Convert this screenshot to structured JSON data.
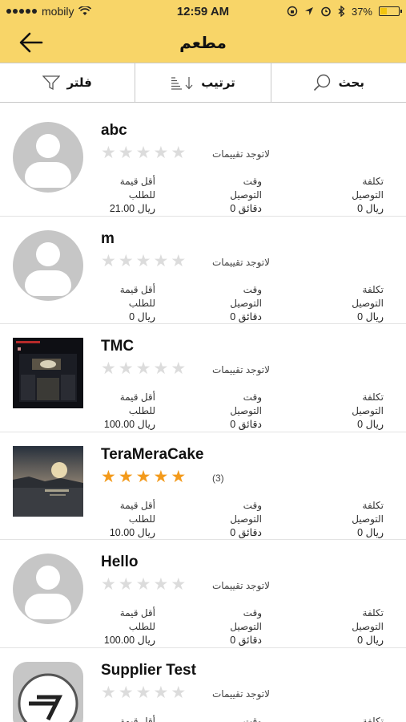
{
  "status": {
    "carrier": "mobily",
    "time": "12:59 AM",
    "battery": "37%",
    "battery_level": 0.37
  },
  "nav": {
    "title": "مطعم"
  },
  "toolbar": {
    "filter": "فلتر",
    "sort": "ترتيب",
    "search": "بحث"
  },
  "labels": {
    "min_order": "أقل قيمة للطلب",
    "delivery_time": "وقت التوصيل",
    "delivery_cost": "تكلفة التوصيل"
  },
  "restaurants": [
    {
      "name": "abc",
      "image": "avatar",
      "stars_filled": 0,
      "rating_text": "لاتوجد تقييمات",
      "min_order": "ريال 21.00",
      "delivery_time": "0 دقائق",
      "delivery_cost": "ريال 0"
    },
    {
      "name": "m",
      "image": "avatar",
      "stars_filled": 0,
      "rating_text": "لاتوجد تقييمات",
      "min_order": "ريال 0",
      "delivery_time": "0 دقائق",
      "delivery_cost": "ريال 0"
    },
    {
      "name": "TMC",
      "image": "photo-night",
      "stars_filled": 0,
      "rating_text": "لاتوجد تقييمات",
      "min_order": "ريال 100.00",
      "delivery_time": "0 دقائق",
      "delivery_cost": "ريال 0"
    },
    {
      "name": "TeraMeraCake",
      "image": "photo-sunset",
      "stars_filled": 5,
      "rating_text": "(3)",
      "min_order": "ريال 10.00",
      "delivery_time": "0 دقائق",
      "delivery_cost": "ريال 0"
    },
    {
      "name": "Hello",
      "image": "avatar",
      "stars_filled": 0,
      "rating_text": "لاتوجد تقييمات",
      "min_order": "ريال 100.00",
      "delivery_time": "0 دقائق",
      "delivery_cost": "ريال 0"
    },
    {
      "name": "Supplier Test",
      "image": "app-icon",
      "stars_filled": 0,
      "rating_text": "لاتوجد تقييمات",
      "min_order": "",
      "delivery_time": "",
      "delivery_cost": ""
    }
  ],
  "colors": {
    "brand": "#f8d568",
    "star_filled": "#f39a1b",
    "star_empty": "#dcdcdc",
    "placeholder": "#c6c6c6"
  }
}
